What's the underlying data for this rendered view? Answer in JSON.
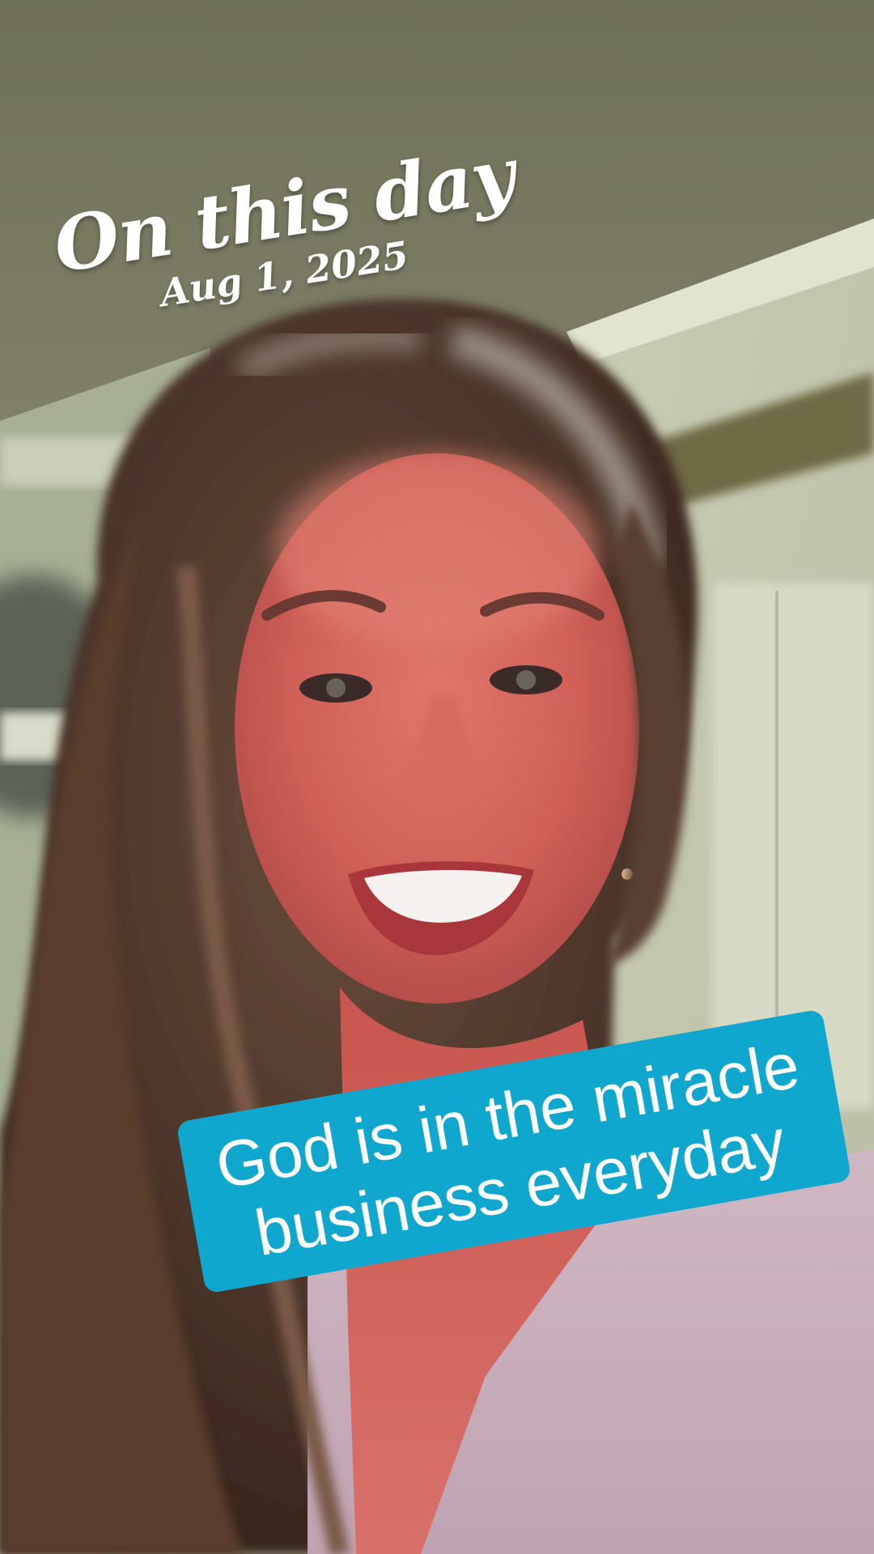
{
  "overlay": {
    "headline": "On this day",
    "date": "Aug 1, 2025"
  },
  "caption": {
    "line1": "God is in the miracle",
    "line2": "business everyday",
    "background_color": "#10a7cf",
    "text_color": "#ffffff"
  }
}
